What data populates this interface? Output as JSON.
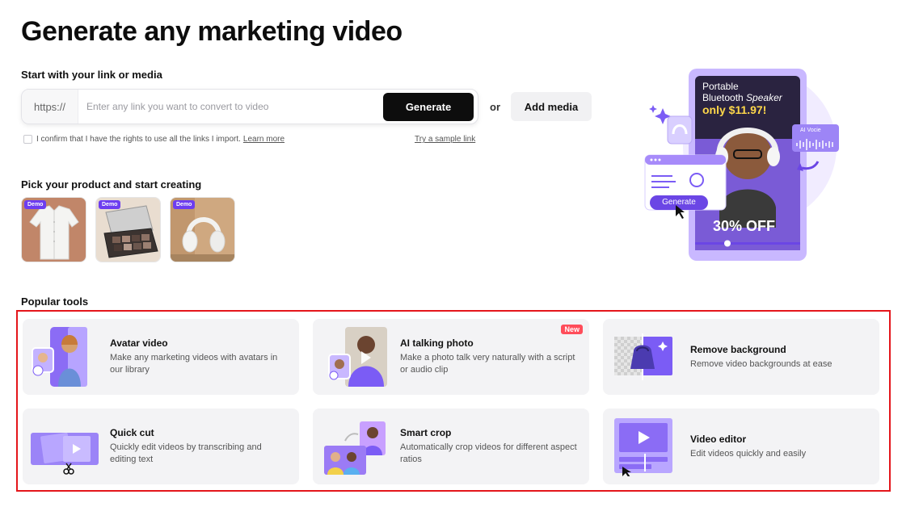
{
  "page": {
    "title": "Generate any marketing video"
  },
  "start": {
    "label": "Start with your link or media",
    "prefix": "https://",
    "placeholder": "Enter any link you want to convert to video",
    "generate_label": "Generate",
    "or_label": "or",
    "add_media_label": "Add media",
    "confirm_text": "I confirm that I have the rights to use all the links I import.",
    "learn_more": "Learn more",
    "sample_link": "Try a sample link"
  },
  "products": {
    "label": "Pick your product and start creating",
    "badge": "Demo",
    "items": [
      "shirt",
      "eyeshadow-palette",
      "headphones"
    ]
  },
  "hero": {
    "product_line1": "Portable",
    "product_line2a": "Bluetooth ",
    "product_line2b": "Speaker",
    "price": "only $11.97!",
    "discount": "30% OFF",
    "ai_voice": "AI Vocie",
    "generate": "Generate",
    "accent": "#7b5cf5"
  },
  "tools": {
    "label": "Popular tools",
    "new_badge": "New",
    "items": [
      {
        "title": "Avatar video",
        "desc": "Make any marketing videos with avatars in our library"
      },
      {
        "title": "AI talking photo",
        "desc": "Make a photo talk very naturally with a script or audio clip"
      },
      {
        "title": "Remove background",
        "desc": "Remove video backgrounds at ease"
      },
      {
        "title": "Quick cut",
        "desc": "Quickly edit videos by transcribing and editing text"
      },
      {
        "title": "Smart crop",
        "desc": "Automatically crop videos for different aspect ratios"
      },
      {
        "title": "Video editor",
        "desc": "Edit videos quickly and easily"
      }
    ]
  }
}
